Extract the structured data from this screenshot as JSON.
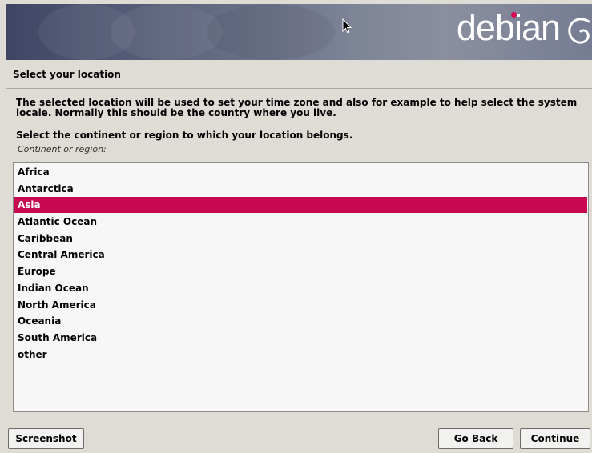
{
  "banner": {
    "brand": "debian",
    "brand_color": "#d70751"
  },
  "page": {
    "title": "Select your location",
    "description": "The selected location will be used to set your time zone and also for example to help select the system locale. Normally this should be the country where you live.",
    "question": "Select the continent or region to which your location belongs.",
    "list_label": "Continent or region:"
  },
  "regions": {
    "items": [
      "Africa",
      "Antarctica",
      "Asia",
      "Atlantic Ocean",
      "Caribbean",
      "Central America",
      "Europe",
      "Indian Ocean",
      "North America",
      "Oceania",
      "South America",
      "other"
    ],
    "selected": "Asia",
    "highlight_color": "#c8084f"
  },
  "buttons": {
    "screenshot": "Screenshot",
    "go_back": "Go Back",
    "continue": "Continue"
  },
  "icons": [
    "debian-swirl-icon",
    "mouse-cursor-icon"
  ]
}
